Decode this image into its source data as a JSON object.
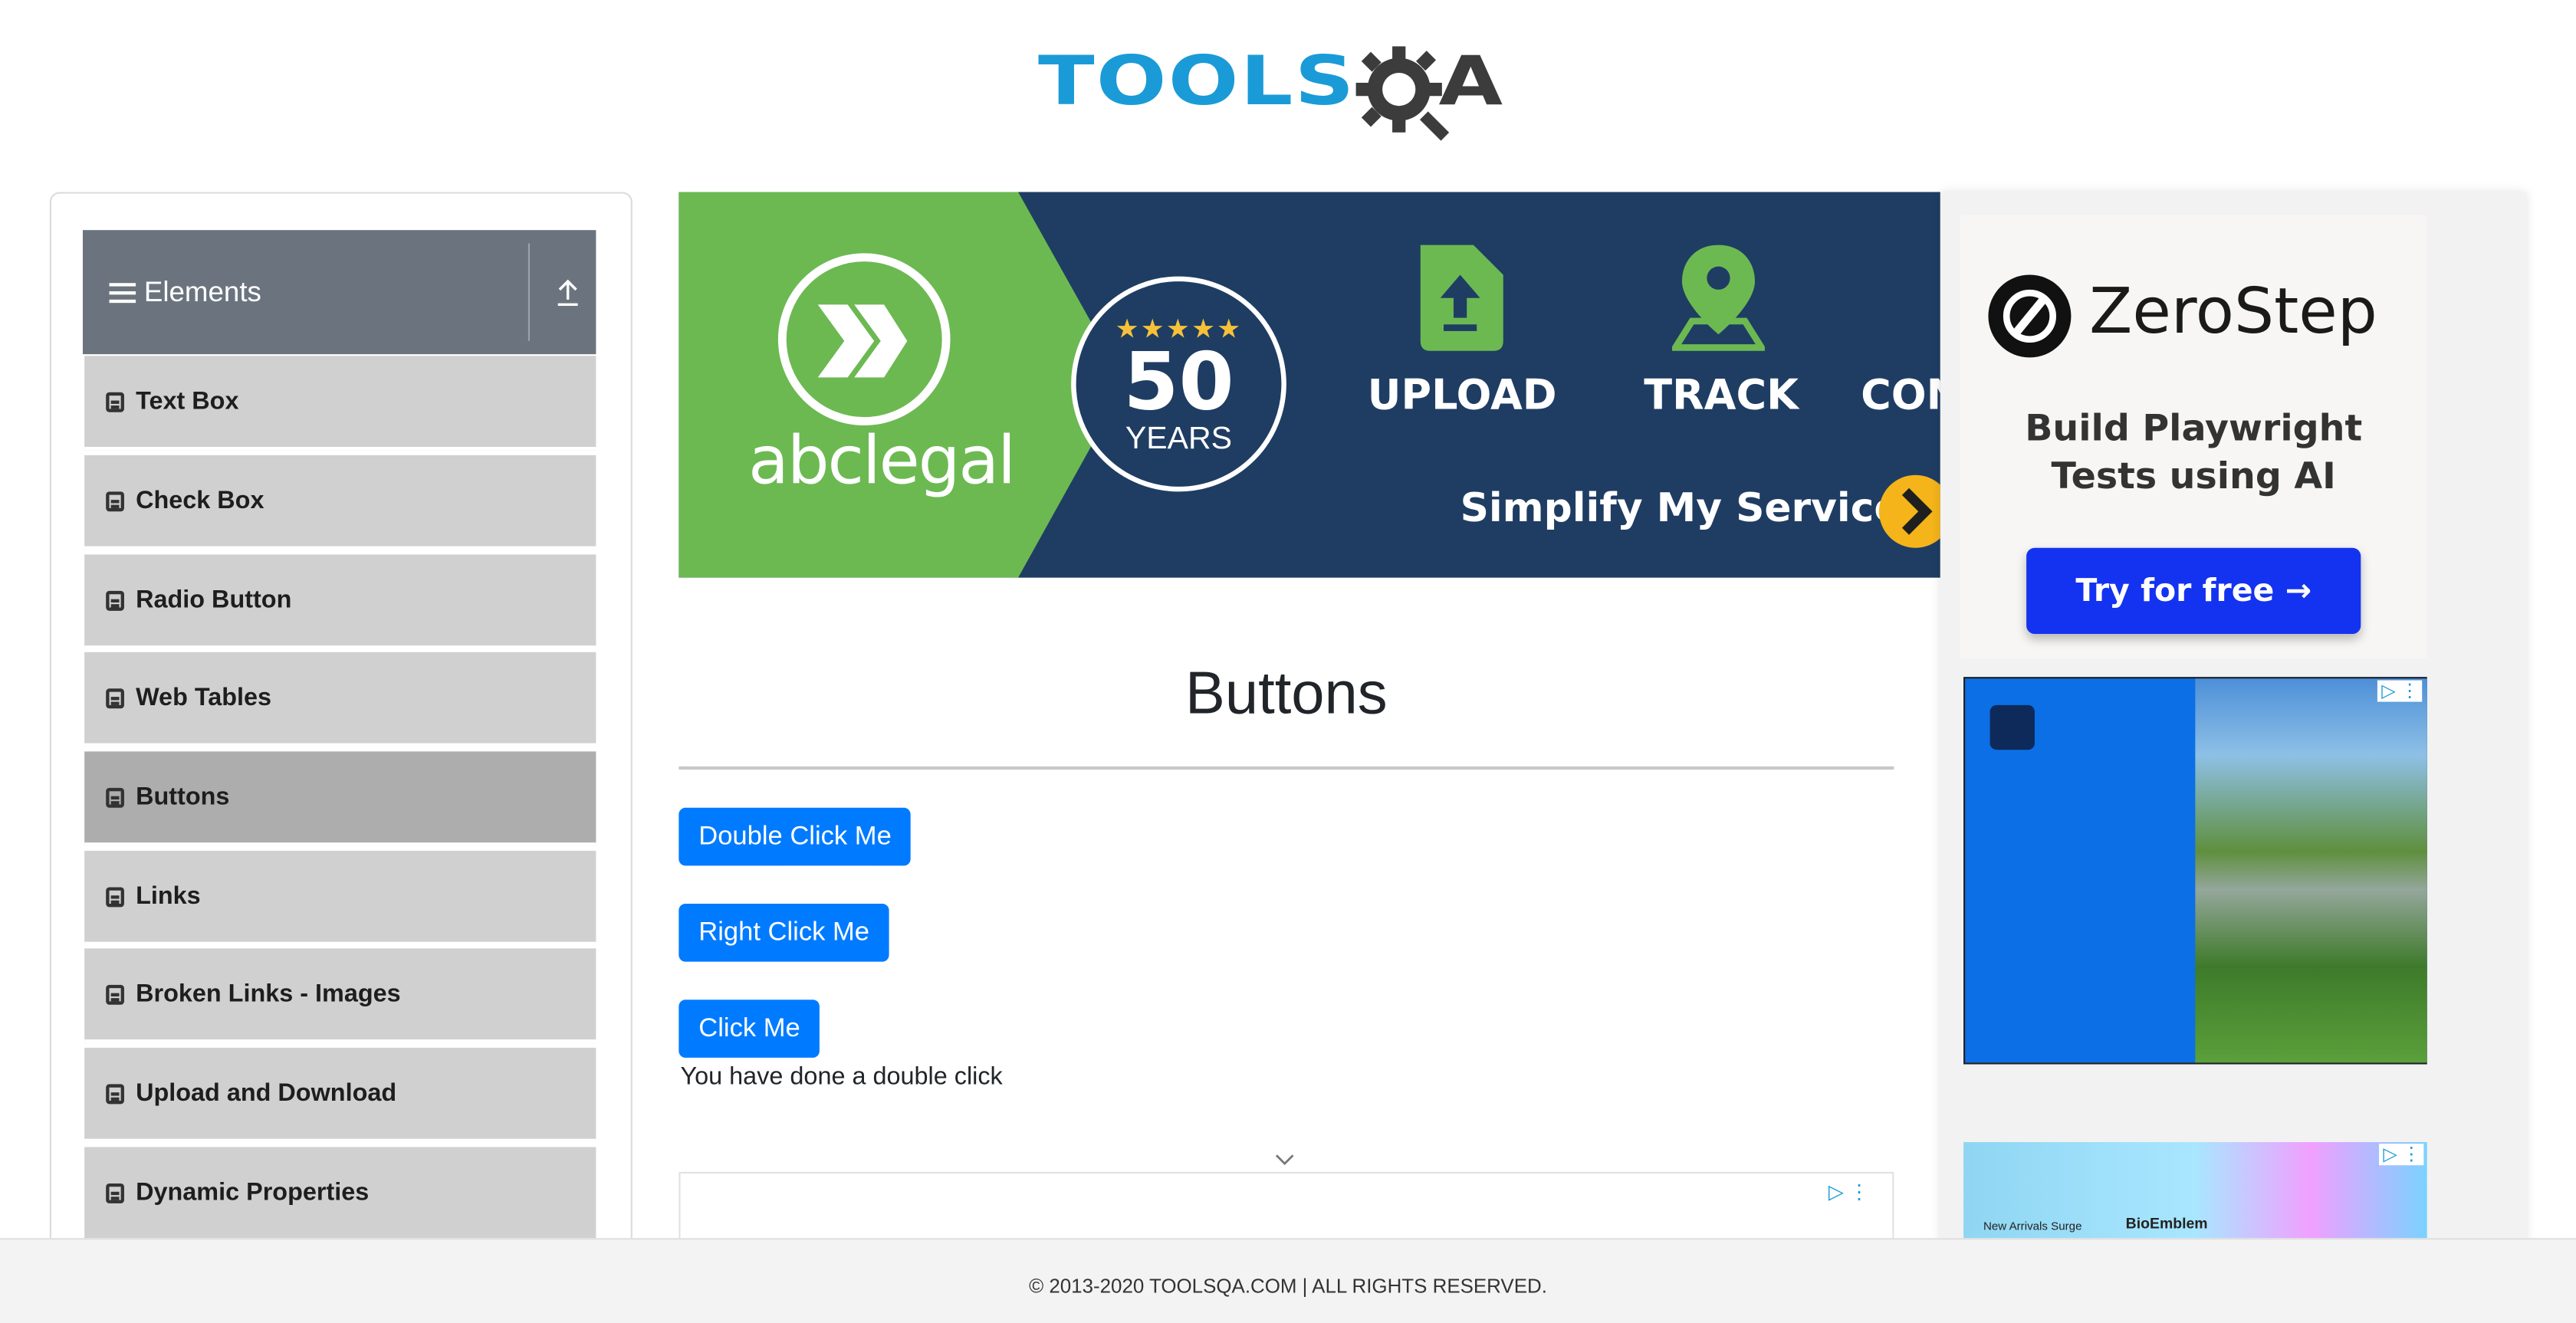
{
  "header": {
    "logo_tools": "TOOLS",
    "logo_qa": "A"
  },
  "sidebar": {
    "group_title": "Elements",
    "items": [
      {
        "label": "Text Box"
      },
      {
        "label": "Check Box"
      },
      {
        "label": "Radio Button"
      },
      {
        "label": "Web Tables"
      },
      {
        "label": "Buttons",
        "active": true
      },
      {
        "label": "Links"
      },
      {
        "label": "Broken Links - Images"
      },
      {
        "label": "Upload and Download"
      },
      {
        "label": "Dynamic Properties"
      }
    ]
  },
  "banner": {
    "brand": "abclegal",
    "stars": "★★★★★",
    "number": "50",
    "years": "YEARS",
    "upload": "UPLOAD",
    "track": "TRACK",
    "con": "CON",
    "cta": "Simplify My Service",
    "colors": {
      "green": "#6cb952",
      "navy": "#1f3d63",
      "gold": "#f4b41a"
    }
  },
  "main": {
    "title": "Buttons",
    "double_click_label": "Double Click Me",
    "right_click_label": "Right Click Me",
    "click_label": "Click Me",
    "message": "You have done a double click",
    "button_color": "#007bff"
  },
  "right_ads": {
    "zerostep_name": "ZeroStep",
    "zerostep_line1": "Build Playwright",
    "zerostep_line2": "Tests using AI",
    "zerostep_cta": "Try for free →",
    "tiktok_text": "New Arrivals Surge",
    "tiktok_brand": "BioEmblem"
  },
  "footer": {
    "text": "© 2013-2020 TOOLSQA.COM | ALL RIGHTS RESERVED."
  }
}
